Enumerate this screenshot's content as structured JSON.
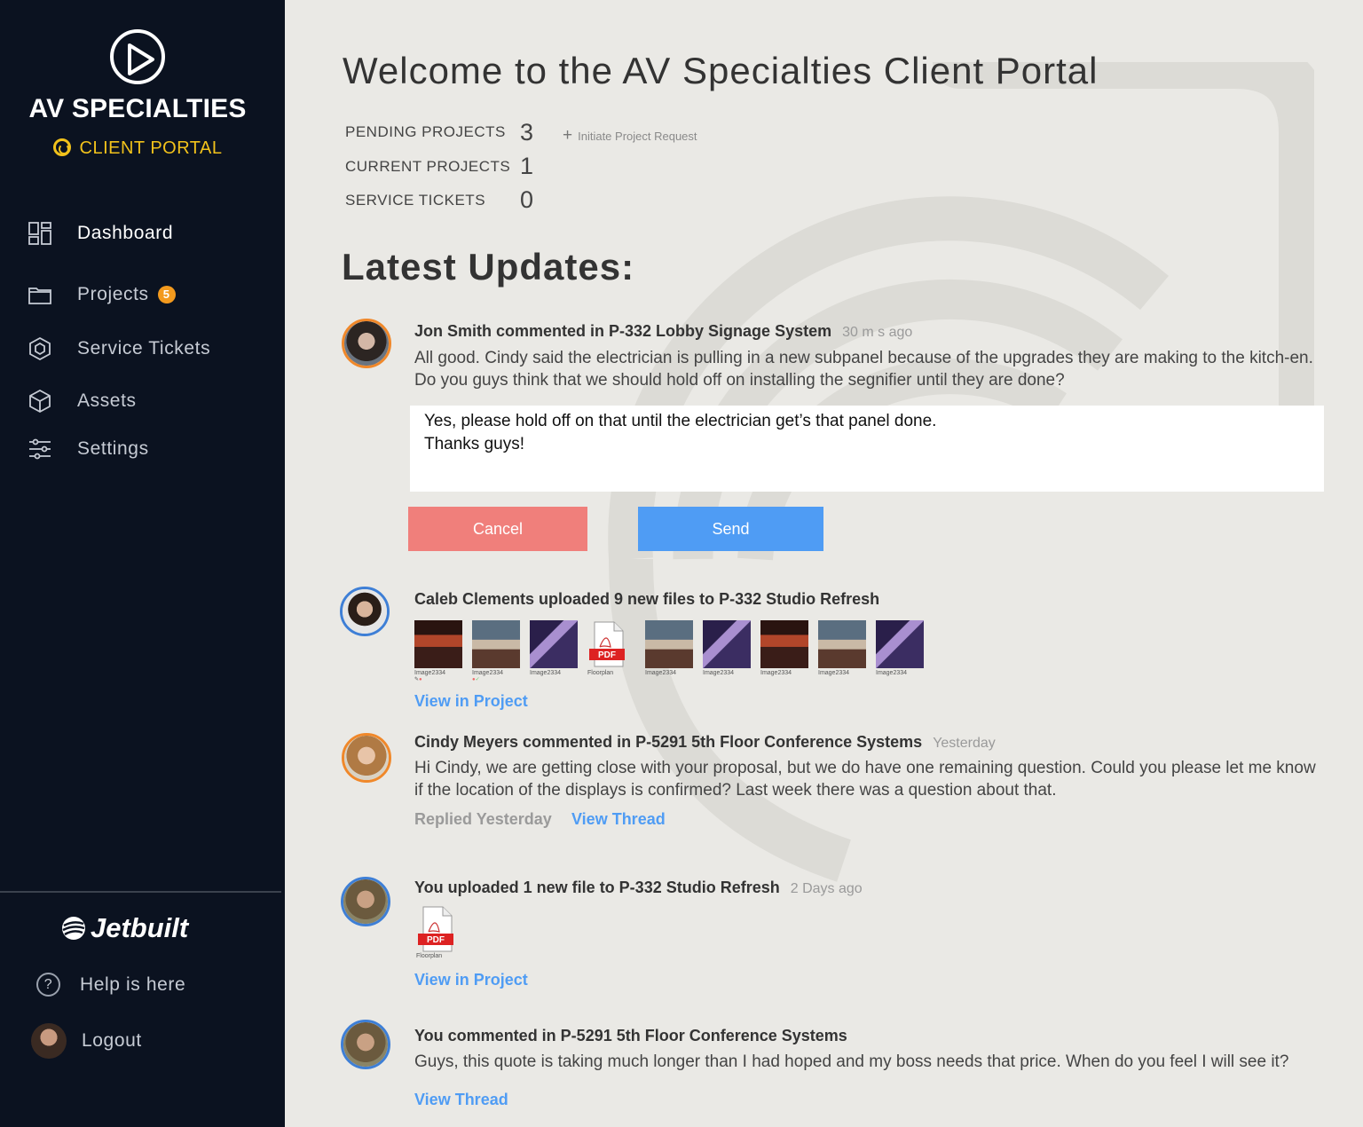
{
  "brand": {
    "name": "AV SPECIALTIES",
    "subtitle": "CLIENT PORTAL"
  },
  "nav": {
    "dashboard": "Dashboard",
    "projects": "Projects",
    "projects_badge": "5",
    "service_tickets": "Service Tickets",
    "assets": "Assets",
    "settings": "Settings"
  },
  "footer": {
    "jetbuilt": "Jetbuilt",
    "help": "Help is here",
    "logout": "Logout"
  },
  "header": {
    "title": "Welcome to the AV Specialties Client Portal"
  },
  "stats": {
    "pending_label": "PENDING PROJECTS",
    "pending_value": "3",
    "current_label": "CURRENT PROJECTS",
    "current_value": "1",
    "tickets_label": "SERVICE TICKETS",
    "tickets_value": "0",
    "initiate": "Initiate Project Request"
  },
  "updates_title": "Latest Updates:",
  "feed": {
    "item1": {
      "head": "Jon Smith commented in P-332 Lobby Signage System",
      "time": "30 m        s ago",
      "body": "All good. Cindy said the  electrician is pulling in a new subpanel because of the upgrades they are making to the kitch-en. Do you guys think that we should hold off on installing the segnifier until they are done?",
      "reply_line1": "Yes, please hold off on that until the electrician get’s that panel done.",
      "reply_line2": "Thanks guys!",
      "cancel": "Cancel",
      "send": "Send"
    },
    "item2": {
      "head": "Caleb Clements uploaded 9 new files to P-332 Studio Refresh",
      "files": [
        "Image2334",
        "Image2334",
        "Image2334",
        "Floorplan",
        "Image2334",
        "Image2334",
        "Image2334",
        "Image2334",
        "Image2334"
      ],
      "pdf_label": "PDF",
      "link": "View in Project"
    },
    "item3": {
      "head": "Cindy Meyers commented in P-5291 5th Floor Conference Systems",
      "time": "Yesterday",
      "body": "Hi Cindy, we are getting close with your proposal, but we do have one remaining question. Could you please let me know if the location of the displays is confirmed? Last week there was a question about that.",
      "replied": "Replied Yesterday",
      "link": "View Thread"
    },
    "item4": {
      "head": "You uploaded 1 new file to P-332 Studio Refresh",
      "time": "2 Days ago",
      "file": "Floorplan",
      "pdf_label": "PDF",
      "link": "View in Project"
    },
    "item5": {
      "head": "You commented in P-5291 5th Floor Conference Systems",
      "body": "Guys, this quote is taking much longer than I had hoped and my boss needs that price. When do you feel I will see it?",
      "link": "View Thread"
    }
  },
  "colors": {
    "sidebar_bg": "#0b1220",
    "accent_yellow": "#f2c21b",
    "badge_orange": "#f39a1e",
    "cancel_red": "#f07f7b",
    "send_blue": "#4f9cf4",
    "link_blue": "#4f9cf4",
    "avatar_orange": "#f0882a",
    "avatar_blue": "#3e7fd6"
  }
}
